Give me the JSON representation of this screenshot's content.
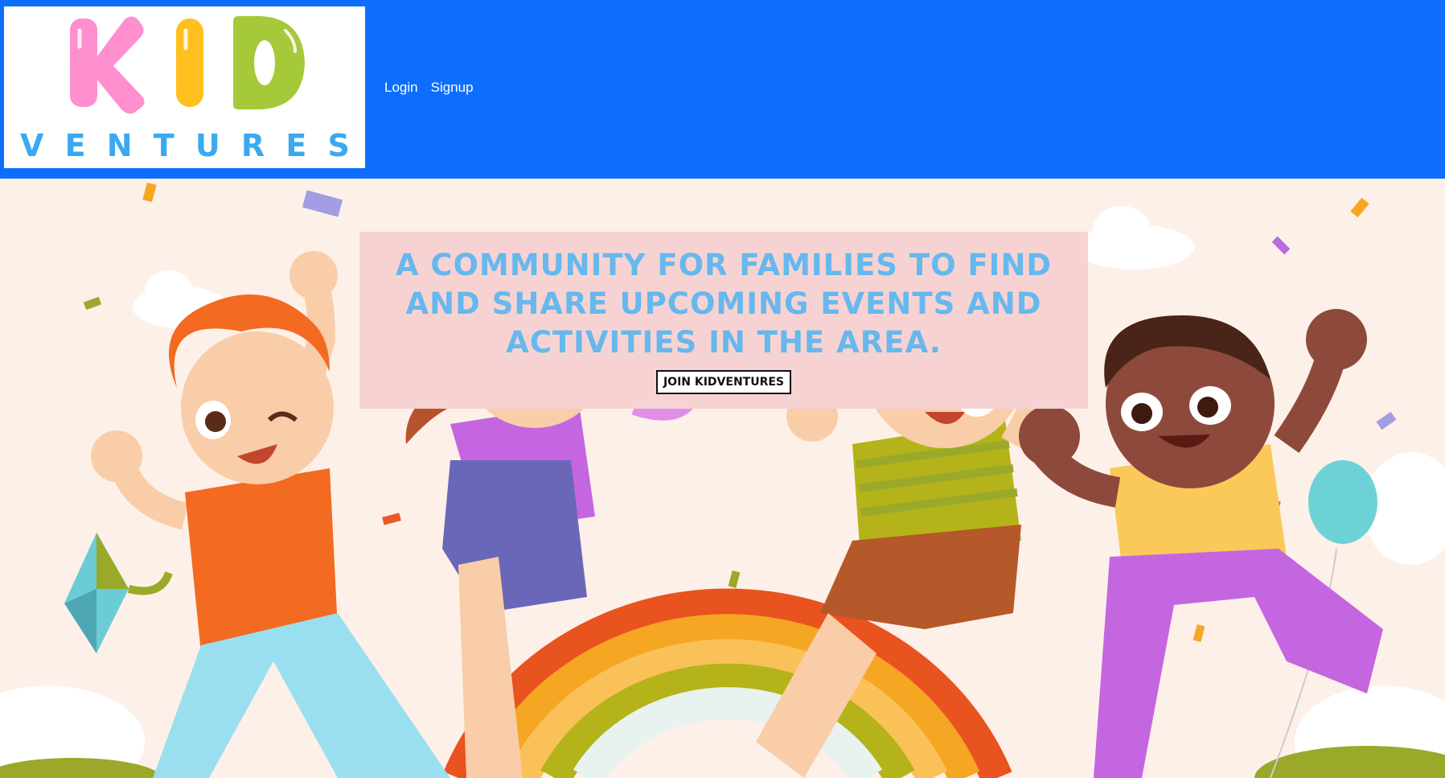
{
  "header": {
    "logo": {
      "text_top": "KID",
      "text_bottom": "VENTURES",
      "letters_bottom": [
        "V",
        "E",
        "N",
        "T",
        "U",
        "R",
        "E",
        "S"
      ],
      "colors": {
        "k": "#ff8fcf",
        "i": "#ffbf1f",
        "d": "#a6c93a",
        "ventures": "#3aa9f0"
      }
    },
    "nav": {
      "login": "Login",
      "signup": "Signup"
    },
    "background_color": "#0d6efd"
  },
  "hero": {
    "headline": "A community for families to find and share upcoming events and activities in the area.",
    "cta_label": "Join KidVentures",
    "banner_color": "#f6d3d2",
    "headline_color": "#66b8ee",
    "illustration": "kids-jumping-over-rainbow"
  }
}
